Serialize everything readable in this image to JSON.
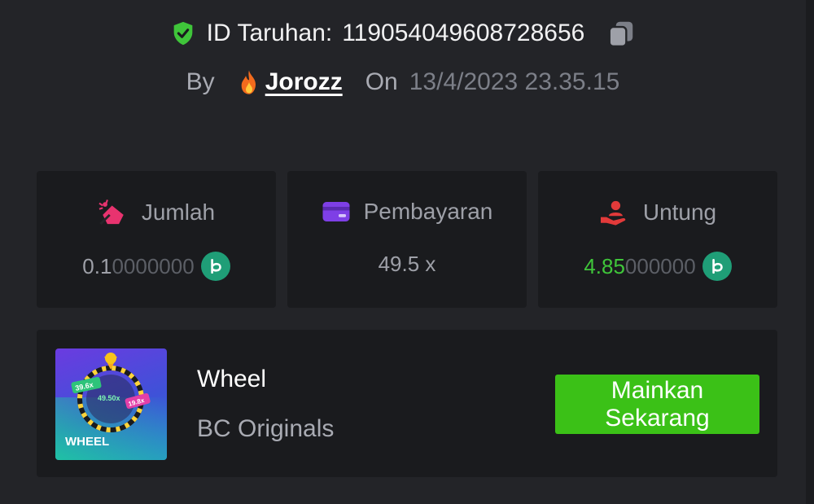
{
  "bet": {
    "id_label": "ID Taruhan:",
    "id_value": "119054049608728656",
    "by_label": "By",
    "username": "Jorozz",
    "on_label": "On",
    "date": "13/4/2023 23.35.15"
  },
  "stats": {
    "amount": {
      "label": "Jumlah",
      "value_main": "0.1",
      "value_dim": "0000000",
      "icon": "money-bag-icon"
    },
    "payout": {
      "label": "Pembayaran",
      "value": "49.5 x",
      "icon": "card-icon"
    },
    "profit": {
      "label": "Untung",
      "value_main": "4.85",
      "value_dim": "000000",
      "icon": "hand-user-icon"
    }
  },
  "game": {
    "title": "Wheel",
    "provider": "BC Originals",
    "thumb_text": "WHEEL",
    "thumb_multipliers": [
      "39.6x",
      "49.50x",
      "19.8x"
    ],
    "play_line1": "Mainkan",
    "play_line2": "Sekarang"
  },
  "colors": {
    "background": "#232428",
    "card": "#1a1b1e",
    "accent_green": "#3bc117",
    "profit_green": "#3fc53a",
    "shield_green": "#3fc53a",
    "coin": "#1f9e77",
    "amount_icon": "#e8336f",
    "payout_icon": "#7e3fe6",
    "profit_icon": "#e23a3a"
  }
}
